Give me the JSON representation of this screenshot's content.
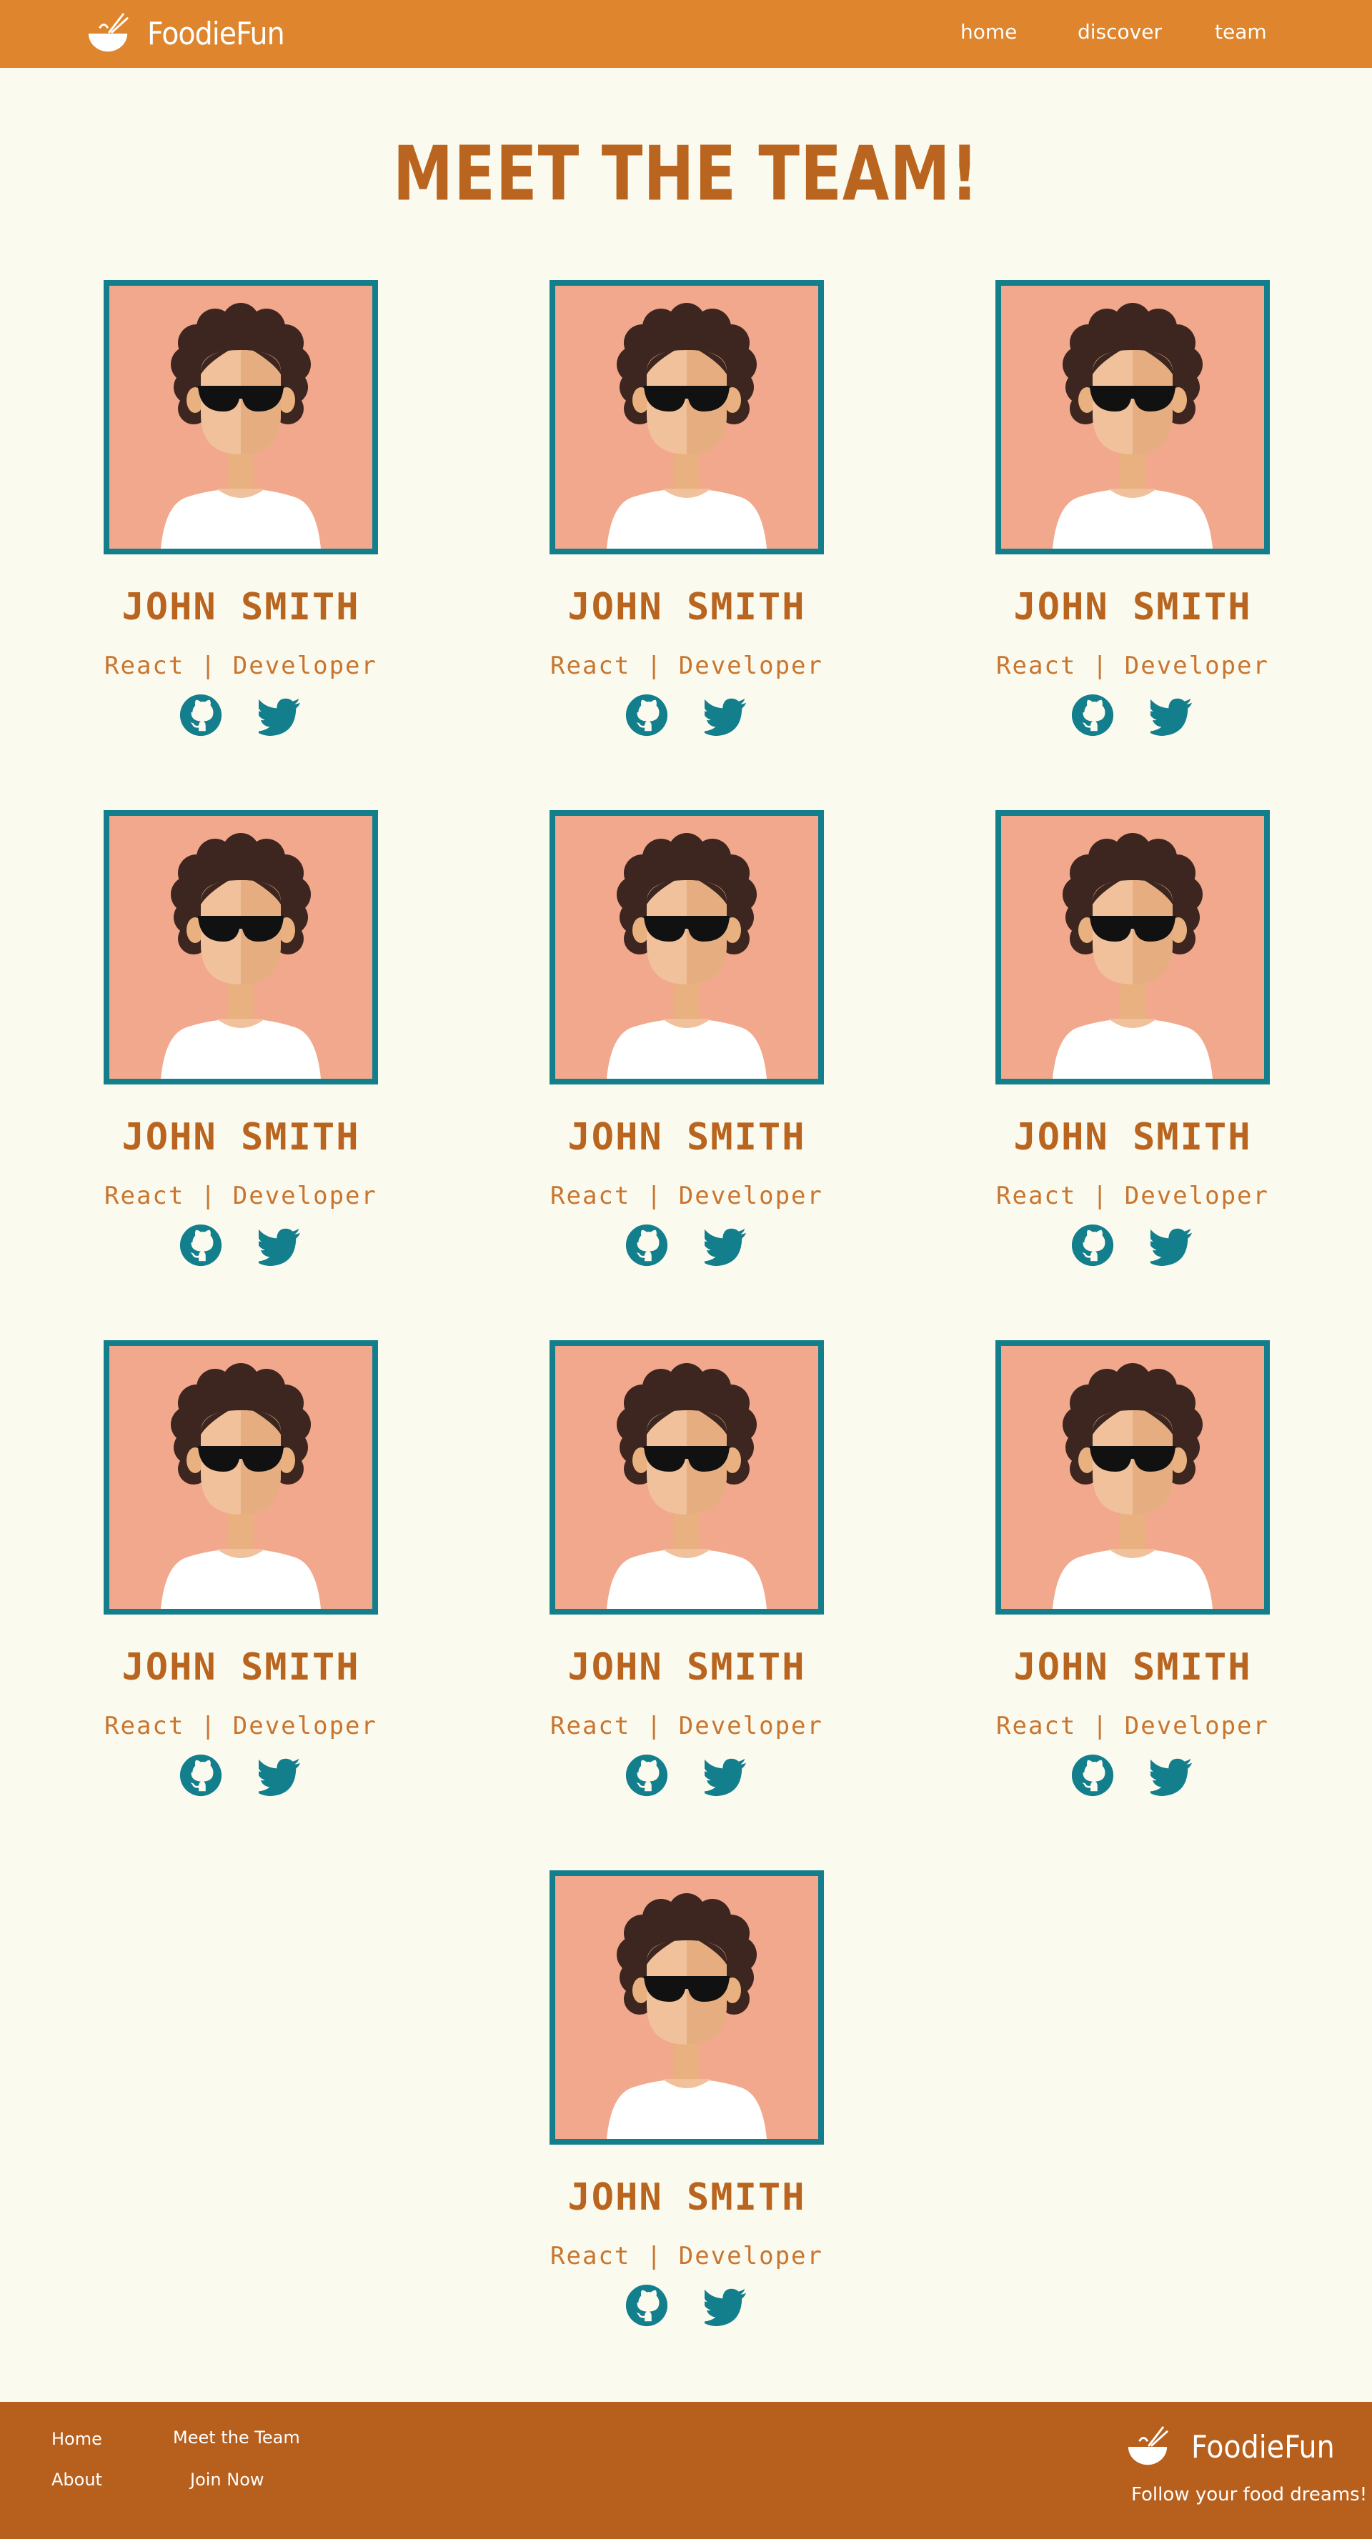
{
  "brand": {
    "name": "FoodieFun",
    "logo_icon": "ramen-bowl-icon"
  },
  "nav": {
    "links": [
      {
        "label": "home"
      },
      {
        "label": "discover"
      },
      {
        "label": "team"
      }
    ]
  },
  "page": {
    "title": "MEET THE TEAM!"
  },
  "team": [
    {
      "name": "JOHN SMITH",
      "role": "React | Developer"
    },
    {
      "name": "JOHN SMITH",
      "role": "React | Developer"
    },
    {
      "name": "JOHN SMITH",
      "role": "React | Developer"
    },
    {
      "name": "JOHN SMITH",
      "role": "React | Developer"
    },
    {
      "name": "JOHN SMITH",
      "role": "React | Developer"
    },
    {
      "name": "JOHN SMITH",
      "role": "React | Developer"
    },
    {
      "name": "JOHN SMITH",
      "role": "React | Developer"
    },
    {
      "name": "JOHN SMITH",
      "role": "React | Developer"
    },
    {
      "name": "JOHN SMITH",
      "role": "React | Developer"
    },
    {
      "name": "JOHN SMITH",
      "role": "React | Developer"
    }
  ],
  "footer": {
    "links": [
      {
        "label": "Home"
      },
      {
        "label": "Meet the Team"
      },
      {
        "label": "About"
      },
      {
        "label": "Join Now"
      }
    ],
    "brand_name": "FoodieFun",
    "tagline": "Follow your food dreams!"
  },
  "colors": {
    "navbar": "#de852d",
    "footer": "#b75f1d",
    "background": "#fbfaee",
    "accent_text": "#b9651f",
    "teal": "#137e8c",
    "avatar_bg": "#f1a88c"
  }
}
